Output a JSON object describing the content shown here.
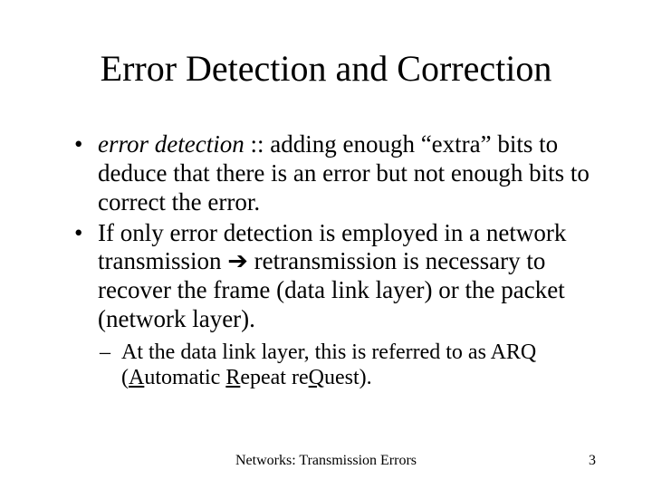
{
  "title": "Error Detection and Correction",
  "bullets": {
    "b1": {
      "term": "error detection",
      "rest": " :: adding enough “extra” bits to deduce that there is an error but not enough bits to correct the error."
    },
    "b2": {
      "pre": "If only error detection is employed in a network transmission ",
      "arrow": "➔",
      "post": " retransmission is necessary to recover the frame (data link layer) or the packet (network layer)."
    },
    "sub1": {
      "pre": "At the data link layer, this is referred to as ",
      "arq": "ARQ",
      "open": " (",
      "a_ul": "A",
      "a_rest": "utomatic ",
      "r_ul": "R",
      "r_rest": "epeat re",
      "q_ul": "Q",
      "q_rest": "uest).",
      "close": ""
    }
  },
  "footer": {
    "center": "Networks: Transmission Errors",
    "page": "3"
  }
}
